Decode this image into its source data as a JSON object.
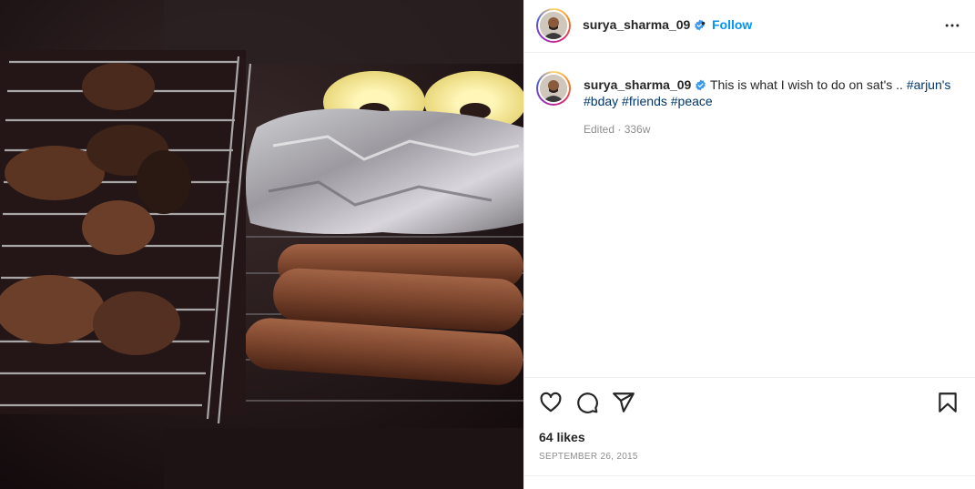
{
  "post": {
    "username": "surya_sharma_09",
    "follow_label": "Follow",
    "separator": "•",
    "caption": {
      "text": "This is what I wish to do on sat's .. ",
      "hashtags": [
        "#arjun's",
        "#bday",
        "#friends",
        "#peace"
      ]
    },
    "edited_label": "Edited · 336w",
    "likes_label": "64 likes",
    "date_label": "September 26, 2015",
    "icons": {
      "verified": "verified-badge-icon",
      "more": "more-options-icon",
      "like": "heart-icon",
      "comment": "comment-icon",
      "share": "share-icon",
      "save": "bookmark-icon"
    },
    "colors": {
      "link": "#0095f6",
      "hashtag": "#00376b",
      "muted": "#8e8e8e",
      "verified": "#3897f0"
    }
  }
}
